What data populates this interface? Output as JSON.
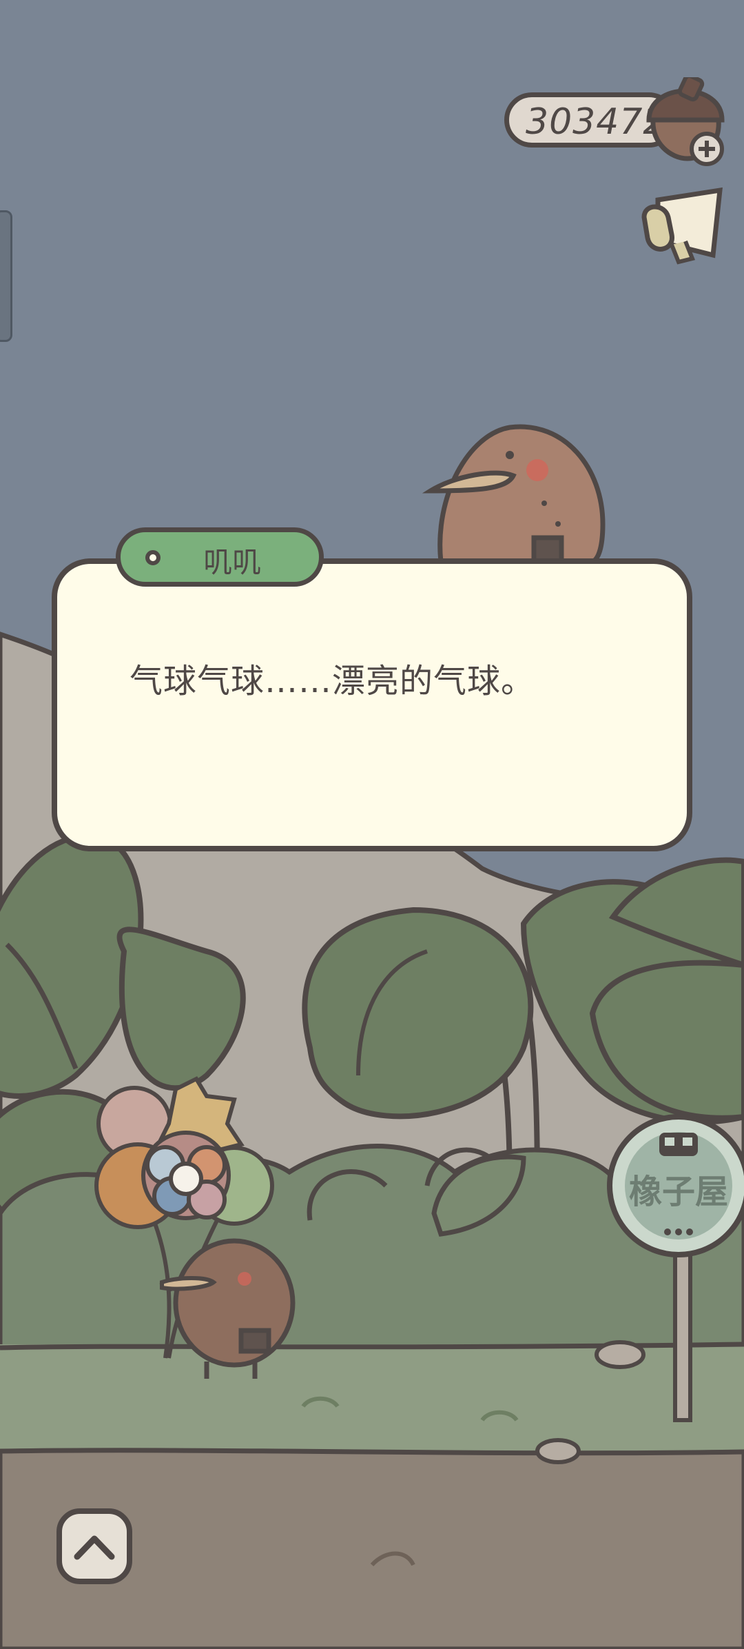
{
  "hud": {
    "coins": "303472",
    "coin_icon": "acorn-icon",
    "add_icon": "plus-icon",
    "announce_icon": "megaphone-icon"
  },
  "dialog": {
    "speaker": "叽叽",
    "text": "气球气球……漂亮的气球。"
  },
  "sign": {
    "text": "橡子屋",
    "icon": "bus-icon"
  },
  "controls": {
    "expand_icon": "chevron-up-icon"
  },
  "colors": {
    "sky": "#7a8594",
    "ground": "#8e8378",
    "grass": "#8f9d84",
    "leaf": "#6e7f63",
    "outline": "#4f4846",
    "dialog_bg": "#fffce9",
    "name_tag": "#7bb07c"
  }
}
